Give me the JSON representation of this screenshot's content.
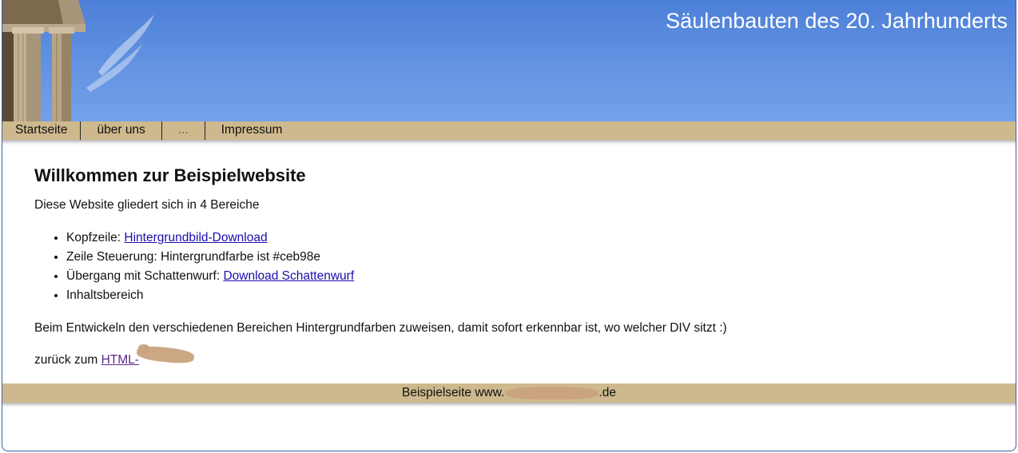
{
  "header": {
    "title": "Säulenbauten des 20. Jahrhunderts",
    "image_icon": "columns-photo"
  },
  "nav": {
    "items": [
      {
        "label": "Startseite"
      },
      {
        "label": "über uns"
      },
      {
        "label": "..."
      },
      {
        "label": "Impressum"
      }
    ]
  },
  "main": {
    "heading": "Willkommen zur Beispielwebsite",
    "intro": "Diese Website gliedert sich in 4 Bereiche",
    "list": [
      {
        "prefix": "Kopfzeile: ",
        "link": "Hintergrundbild-Download"
      },
      {
        "prefix": "Zeile Steuerung: Hintergrundfarbe ist #ceb98e",
        "link": ""
      },
      {
        "prefix": "Übergang mit Schattenwurf: ",
        "link": "Download Schattenwurf"
      },
      {
        "prefix": "Inhaltsbereich",
        "link": ""
      }
    ],
    "note": "Beim Entwickeln den verschiedenen Bereichen Hintergrundfarben zuweisen, damit sofort erkennbar ist, wo welcher DIV sitzt :)",
    "back_prefix": "zurück zum ",
    "back_link": "HTML-"
  },
  "footer": {
    "text_prefix": "Beispielseite www.",
    "text_suffix": ".de"
  },
  "colors": {
    "nav_bg": "#ceb98e",
    "header_sky": "#5d8edf",
    "link": "#1a0dab",
    "redaction": "#c9a27d"
  }
}
